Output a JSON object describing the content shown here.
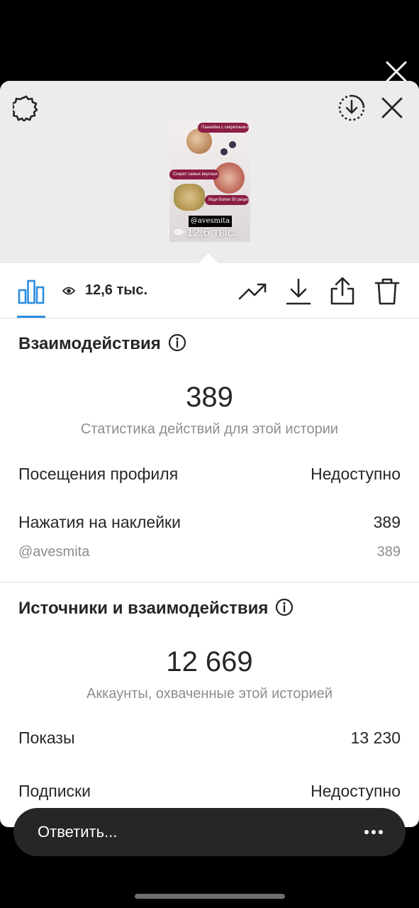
{
  "top": {
    "close_icon": "close-icon"
  },
  "preview": {
    "settings_icon": "gear-icon",
    "save_icon": "download-circle-icon",
    "close_icon": "close-icon",
    "story_texts": [
      "Панкейки с секретным ингредиентом",
      "Секрет самых вкусных домашних бургеров",
      "Ищи более 50 рецептов 10-минуток"
    ],
    "story_handle": "@avesmita",
    "story_views": "12,6 тыс."
  },
  "toolbar": {
    "views": "12,6 тыс.",
    "icons": [
      "insights-icon",
      "eye-icon",
      "trending-icon",
      "download-icon",
      "share-icon",
      "trash-icon"
    ],
    "accent": "#2a8ee0"
  },
  "interactions": {
    "title": "Взаимодействия",
    "total": "389",
    "caption": "Статистика действий для этой истории",
    "rows": [
      {
        "label": "Посещения профиля",
        "value": "Недоступно"
      },
      {
        "label": "Нажатия на наклейки",
        "value": "389"
      }
    ],
    "sticker": {
      "label": "@avesmita",
      "value": "389"
    }
  },
  "reach": {
    "title": "Источники и взаимодействия",
    "total": "12 669",
    "caption": "Аккаунты, охваченные этой историей",
    "rows": [
      {
        "label": "Показы",
        "value": "13 230"
      },
      {
        "label": "Подписки",
        "value": "Недоступно"
      }
    ]
  },
  "reply": {
    "placeholder": "Ответить...",
    "more_icon": "more-icon"
  }
}
